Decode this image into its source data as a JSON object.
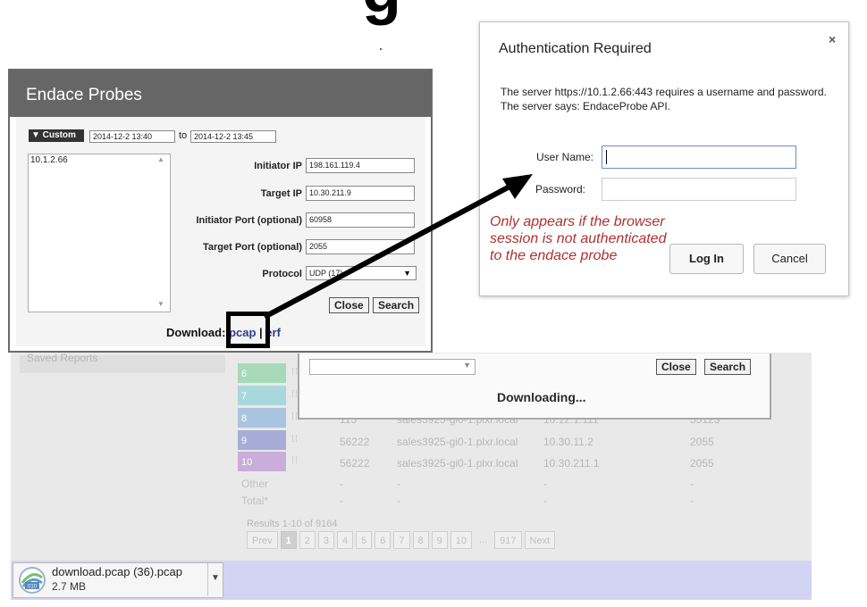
{
  "page_title_fragment": "g",
  "background_app": {
    "sidebar_item": "Saved Reports",
    "rows": [
      {
        "num": "6",
        "color": "#a7d9b9",
        "c1": "",
        "c2": "",
        "c3": "",
        "c4": ""
      },
      {
        "num": "7",
        "color": "#a9d8dc",
        "c1": "",
        "c2": "",
        "c3": "",
        "c4": ""
      },
      {
        "num": "8",
        "color": "#a9c4df",
        "c1": "115",
        "c2": "sales3925-gi0-1.plxr.local",
        "c3": "10.12.1.111",
        "c4": "55123"
      },
      {
        "num": "9",
        "color": "#a6acd6",
        "c1": "56222",
        "c2": "sales3925-gi0-1.plxr.local",
        "c3": "10.30.11.2",
        "c4": "2055"
      },
      {
        "num": "10",
        "color": "#c9aed9",
        "c1": "56222",
        "c2": "sales3925-gi0-1.plxr.local",
        "c3": "10.30.211.1",
        "c4": "2055"
      }
    ],
    "other_label": "Other",
    "total_label": "Total*",
    "dash": "-",
    "results_text": "Results 1-10 of 9164",
    "pager": {
      "prev": "Prev",
      "pages": [
        "1",
        "2",
        "3",
        "4",
        "5",
        "6",
        "7",
        "8",
        "9",
        "10"
      ],
      "ellipsis": "...",
      "last": "917",
      "next": "Next",
      "active": "1"
    },
    "downloading_dialog": {
      "close": "Close",
      "search": "Search",
      "status": "Downloading..."
    }
  },
  "download_bar": {
    "filename": "download.pcap (36).pcap",
    "size": "2.7 MB",
    "icon": "pcap-file-icon",
    "menu_icon": "chevron-down-icon",
    "bar_color": "#d3d4f4"
  },
  "endace_dialog": {
    "title": "Endace Probes",
    "custom_label": "▼ Custom",
    "from": "2014-12-2 13:40",
    "to_label": "to",
    "to": "2014-12-2 13:45",
    "probe": "10.1.2.66",
    "fields": {
      "initiator_ip_label": "Initiator IP",
      "initiator_ip": "198.161.119.4",
      "target_ip_label": "Target IP",
      "target_ip": "10.30.211.9",
      "initiator_port_label": "Initiator Port (optional)",
      "initiator_port": "60958",
      "target_port_label": "Target Port (optional)",
      "target_port": "2055",
      "protocol_label": "Protocol",
      "protocol": "UDP (17)"
    },
    "close": "Close",
    "search": "Search",
    "download_label": "Download:",
    "pcap": "pcap",
    "sep": "|",
    "erf": "erf",
    "header_color": "#666666"
  },
  "auth_dialog": {
    "title": "Authentication Required",
    "message": "The server https://10.1.2.66:443 requires a username and password. The server says: EndaceProbe API.",
    "username_label": "User Name:",
    "password_label": "Password:",
    "login": "Log In",
    "cancel": "Cancel",
    "close_icon": "×"
  },
  "annotation": {
    "note": "Only appears if the browser session is not authenticated to the endace probe",
    "color": "#b03030"
  }
}
